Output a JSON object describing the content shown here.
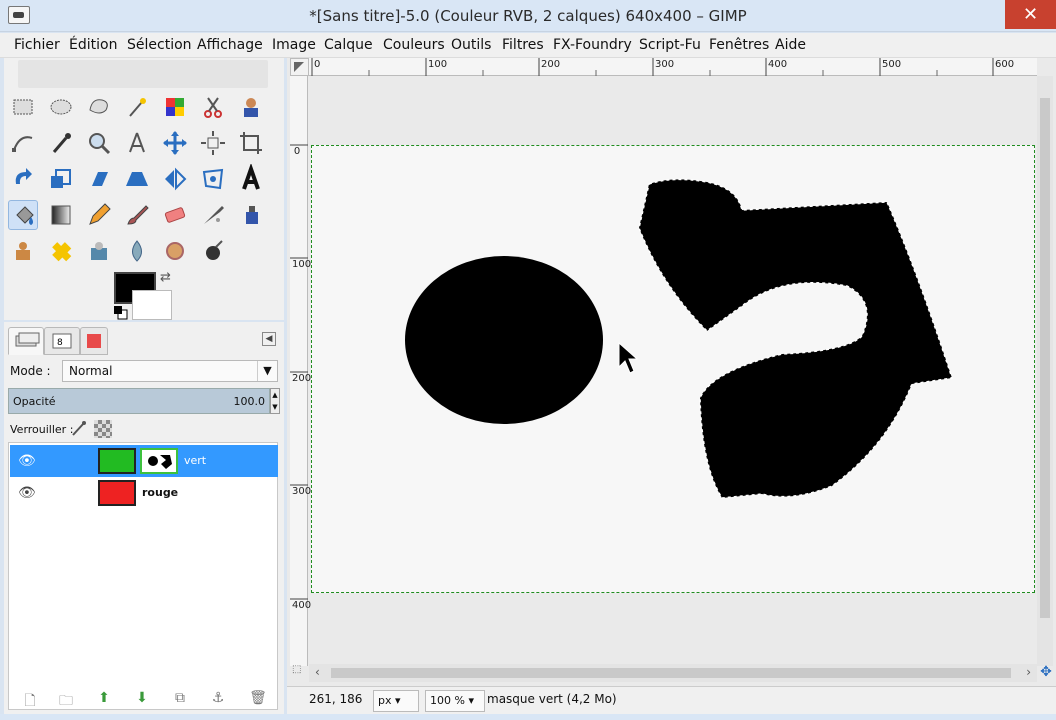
{
  "window": {
    "title": "*[Sans titre]-5.0 (Couleur RVB, 2 calques) 640x400 – GIMP",
    "close": "✕"
  },
  "menubar": [
    "Fichier",
    "Édition",
    "Sélection",
    "Affichage",
    "Image",
    "Calque",
    "Couleurs",
    "Outils",
    "Filtres",
    "FX-Foundry",
    "Script-Fu",
    "Fenêtres",
    "Aide"
  ],
  "toolbox": {
    "tools": [
      "rect-select",
      "ellipse-select",
      "free-select",
      "fuzzy-select",
      "select-by-color",
      "scissors",
      "foreground-select",
      "paths",
      "color-picker",
      "zoom",
      "measure",
      "move",
      "align",
      "crop",
      "rotate",
      "scale",
      "shear",
      "perspective",
      "flip",
      "cage",
      "text",
      "bucket-fill",
      "blend",
      "pencil",
      "paintbrush",
      "eraser",
      "airbrush",
      "ink",
      "clone",
      "heal",
      "dodge-burn",
      "smudge",
      "blur",
      "convolve"
    ],
    "active_tool": "bucket-fill",
    "fg_color": "#000000",
    "bg_color": "#ffffff",
    "swap_icon": "⇄",
    "reset_icon": "▪"
  },
  "layers": {
    "mode_label": "Mode :",
    "mode_value": "Normal",
    "opacity_label": "Opacité",
    "opacity_value": "100.0",
    "lock_label": "Verrouiller :",
    "items": [
      {
        "name": "vert",
        "color": "#22bb22",
        "selected": true,
        "has_mask": true
      },
      {
        "name": "rouge",
        "color": "#ee2222",
        "selected": false,
        "has_mask": false
      }
    ]
  },
  "rulers": {
    "horizontal": [
      "0",
      "100",
      "200",
      "300",
      "400",
      "500",
      "600"
    ],
    "vertical": [
      "0",
      "100",
      "200",
      "300",
      "400"
    ]
  },
  "status": {
    "coords": "261, 186",
    "unit": "px",
    "zoom": "100 %",
    "message": "masque vert (4,2 Mo)"
  }
}
